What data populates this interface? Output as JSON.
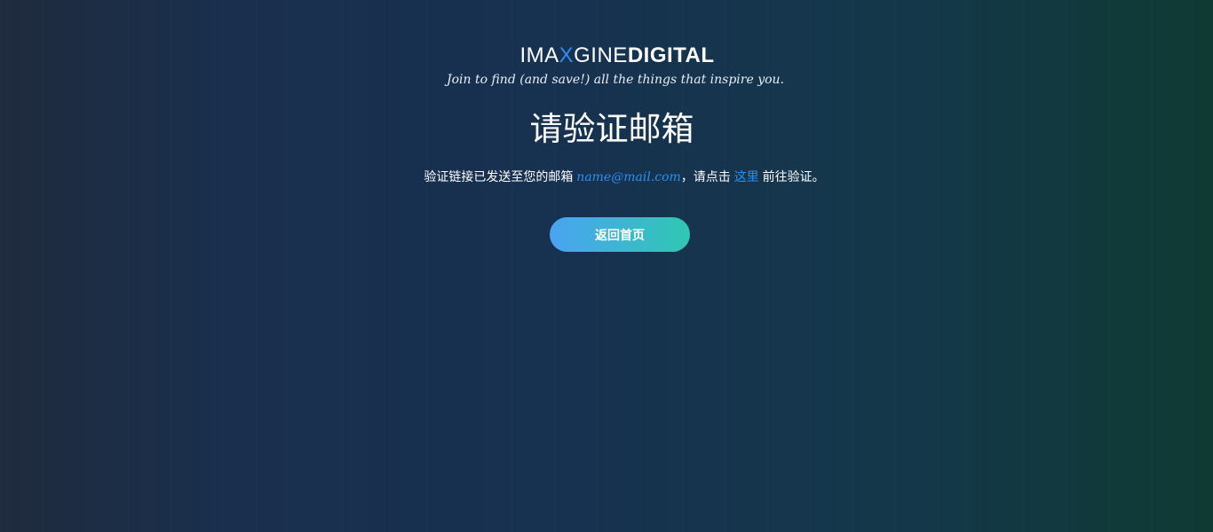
{
  "brand": {
    "logo_part1": "IMA",
    "logo_x": "X",
    "logo_part2": "GINE",
    "logo_part3": "DIGITAL",
    "tagline": "Join to find (and save!) all the things that inspire you.",
    "accent_color": "#2a8ff0"
  },
  "main": {
    "title": "请验证邮箱",
    "message_prefix": "验证链接已发送至您的邮箱",
    "email": "name@mail.com",
    "message_middle": "，请点击",
    "link_text": "这里",
    "message_suffix": "前往验证。"
  },
  "actions": {
    "home_button_label": "返回首页",
    "button_gradient": [
      "#4aa3f2",
      "#2fc8b2"
    ]
  }
}
